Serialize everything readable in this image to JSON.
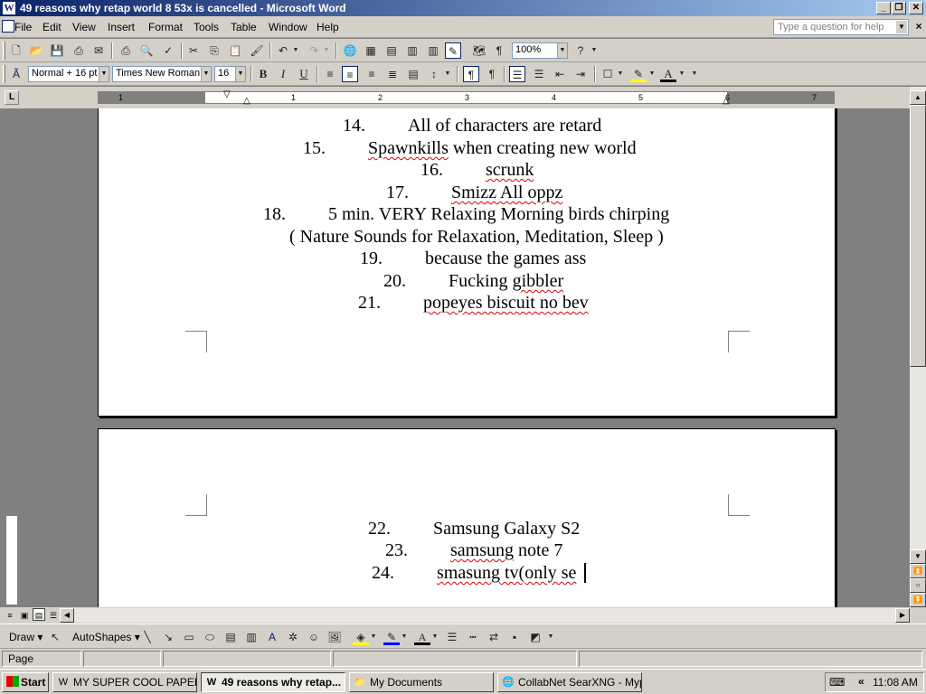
{
  "window": {
    "title": "49  reasons why retap world 8 53x is cancelled - Microsoft Word",
    "app_icon": "W",
    "controls": [
      "minimize-icon",
      "restore-icon",
      "close-icon"
    ]
  },
  "menubar": {
    "items": [
      {
        "label": "File"
      },
      {
        "label": "Edit"
      },
      {
        "label": "View"
      },
      {
        "label": "Insert"
      },
      {
        "label": "Format"
      },
      {
        "label": "Tools"
      },
      {
        "label": "Table"
      },
      {
        "label": "Window"
      },
      {
        "label": "Help"
      }
    ],
    "ask_placeholder": "Type a question for help"
  },
  "standard_toolbar": {
    "zoom": "100%"
  },
  "formatting_toolbar": {
    "style": "Normal + 16 pt",
    "font": "Times New Roman",
    "size": "16",
    "bold": "B",
    "italic": "I",
    "underline": "U",
    "font_color_letter": "A"
  },
  "ruler": {
    "numbers": [
      "1",
      "1",
      "2",
      "3",
      "4",
      "5",
      "6",
      "7"
    ]
  },
  "document": {
    "page1_lines": [
      {
        "num": "14.",
        "text": "All of characters are retard",
        "squiggle": ""
      },
      {
        "num": "15.",
        "text": "Spawnkills when creating new world",
        "squiggle": "Spawnkills"
      },
      {
        "num": "16.",
        "text": "scrunk",
        "squiggle": "scrunk"
      },
      {
        "num": "17.",
        "text": "Smizz All oppz",
        "squiggle": "all"
      },
      {
        "num": "18.",
        "text": "5 min. VERY Relaxing Morning birds chirping",
        "squiggle": ""
      },
      {
        "num": "",
        "text": "( Nature Sounds for Relaxation, Meditation, Sleep )",
        "squiggle": ""
      },
      {
        "num": "19.",
        "text": "because the games ass",
        "squiggle": ""
      },
      {
        "num": "20.",
        "text": "Fucking gibbler",
        "squiggle": "gibbler"
      },
      {
        "num": "21.",
        "text": "popeyes biscuit no bev",
        "squiggle": "all"
      }
    ],
    "page2_lines": [
      {
        "num": "22.",
        "text": "Samsung Galaxy S2",
        "squiggle": ""
      },
      {
        "num": "23.",
        "text": "samsung note 7",
        "squiggle": "samsung"
      },
      {
        "num": "24.",
        "text": "smasung tv(only se",
        "squiggle": "all"
      }
    ]
  },
  "drawing_toolbar": {
    "draw_label": "Draw",
    "autoshapes_label": "AutoShapes"
  },
  "statusbar": {
    "page_label": "Page"
  },
  "taskbar": {
    "start_label": "Start",
    "tasks": [
      {
        "label": "MY SUPER COOL PAPER ...",
        "icon": "word-doc-icon",
        "active": false
      },
      {
        "label": "49  reasons why retap...",
        "icon": "word-doc-icon",
        "active": true
      },
      {
        "label": "My Documents",
        "icon": "folder-icon",
        "active": false
      },
      {
        "label": "CollabNet SearXNG - Mypal",
        "icon": "browser-icon",
        "active": false
      }
    ],
    "tray_arrows": "«",
    "clock": "11:08 AM"
  }
}
